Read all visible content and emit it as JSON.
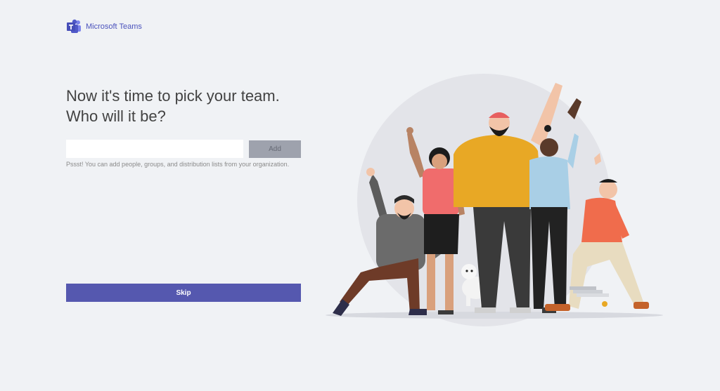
{
  "app": {
    "name": "Microsoft Teams",
    "logo_icon": "teams-logo-icon",
    "accent_color": "#5558af"
  },
  "main": {
    "heading": "Now it's time to pick your team. Who will it be?",
    "input": {
      "value": "",
      "placeholder": ""
    },
    "add_label": "Add",
    "hint": "Pssst! You can add people, groups, and distribution lists from your organization.",
    "skip_label": "Skip"
  },
  "illustration": {
    "icon": "team-people-illustration"
  }
}
